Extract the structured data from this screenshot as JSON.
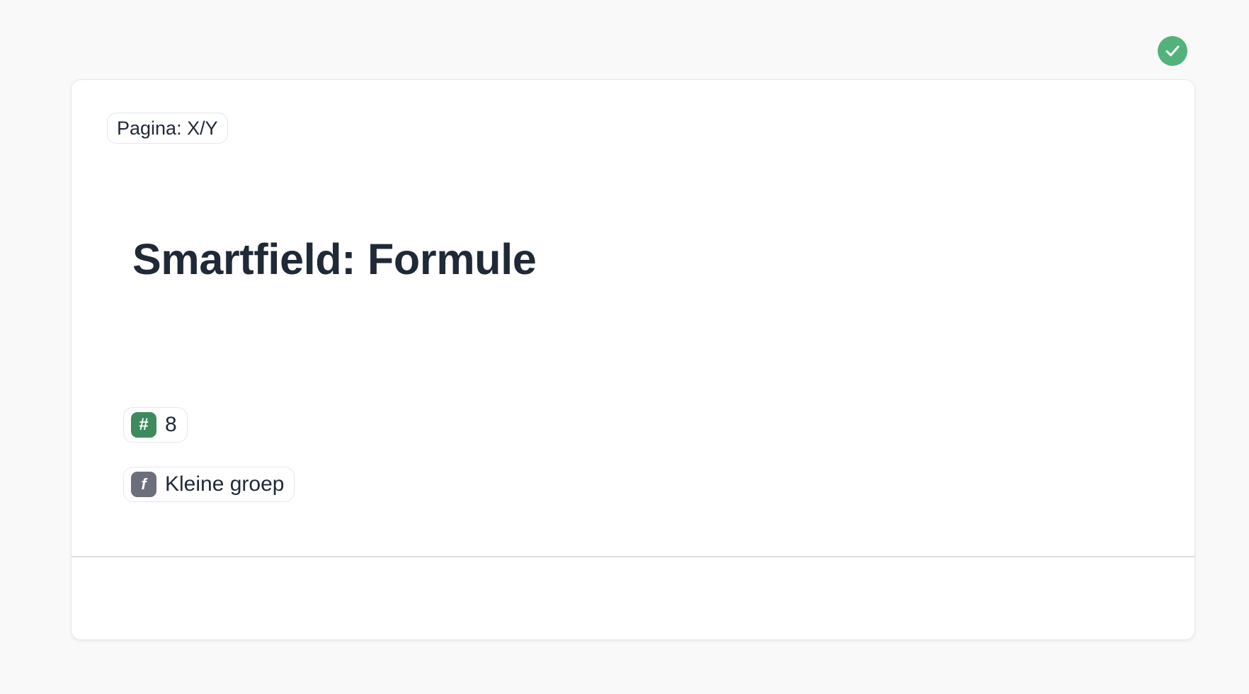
{
  "status": {
    "icon": "check-circle-icon",
    "color": "#52b27a"
  },
  "card": {
    "page_indicator": "Pagina: X/Y",
    "title": "Smartfield: Formule",
    "fields": [
      {
        "icon": "hash-icon",
        "icon_glyph": "#",
        "icon_color": "#3f8a5c",
        "value": "8"
      },
      {
        "icon": "function-icon",
        "icon_glyph": "f",
        "icon_color": "#6b6f7b",
        "value": "Kleine groep"
      }
    ]
  }
}
